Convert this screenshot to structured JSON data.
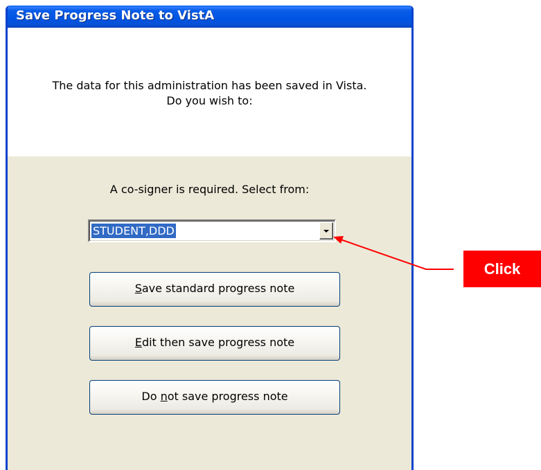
{
  "dialog": {
    "title": "Save Progress Note to VistA",
    "message_line1": "The data for this administration has been saved in Vista.",
    "message_line2": "Do you wish to:",
    "cosigner_label": "A co-signer is required. Select from:",
    "cosigner_selected": "STUDENT,DDD",
    "buttons": {
      "save_standard": {
        "pre": "",
        "accel": "S",
        "post": "ave standard progress note"
      },
      "edit_then_save": {
        "pre": "",
        "accel": "E",
        "post": "dit then save progress note"
      },
      "do_not_save": {
        "pre": "Do ",
        "accel": "n",
        "post": "ot save progress note"
      }
    }
  },
  "annotation": {
    "label": "Click",
    "color": "#ff0000"
  },
  "colors": {
    "titlebar": "#0054e3",
    "window_frame": "#0842cc",
    "dialog_face": "#ece9d8",
    "selection": "#316ac5"
  },
  "icons": {
    "dropdown": "chevron-down-icon"
  }
}
